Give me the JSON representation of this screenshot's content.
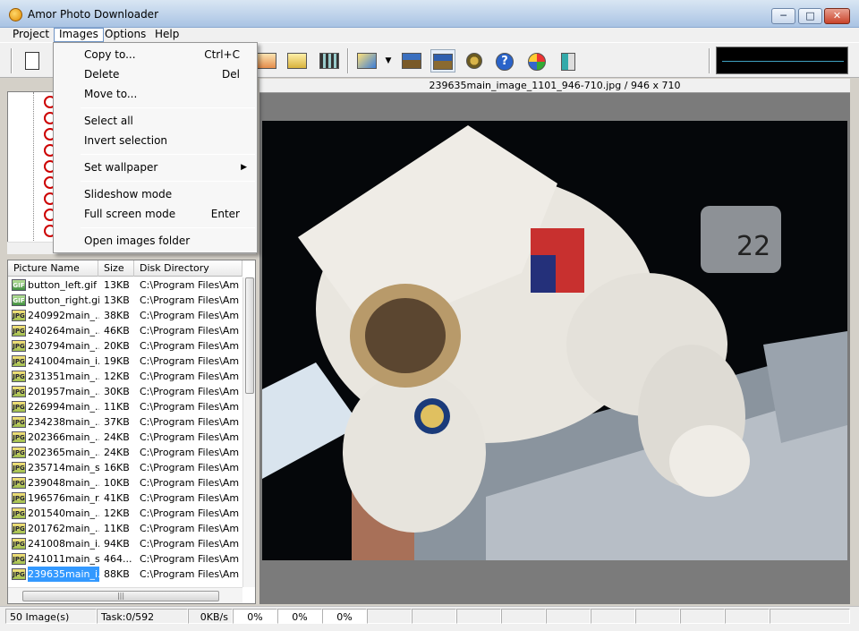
{
  "window": {
    "title": "Amor Photo Downloader",
    "min_glyph": "─",
    "max_glyph": "□",
    "close_glyph": "✕"
  },
  "menubar": {
    "project": "Project",
    "images": "Images",
    "options": "Options",
    "help": "Help"
  },
  "images_menu": {
    "copy": "Copy to...",
    "copy_shortcut": "Ctrl+C",
    "delete": "Delete",
    "delete_shortcut": "Del",
    "move": "Move to...",
    "select_all": "Select all",
    "invert": "Invert selection",
    "wallpaper": "Set wallpaper",
    "wallpaper_arrow": "▶",
    "slideshow": "Slideshow mode",
    "fullscreen": "Full screen mode",
    "fullscreen_shortcut": "Enter",
    "open_folder": "Open images folder"
  },
  "toolbar": {
    "icons": [
      "new-project-icon",
      "image-icon",
      "folder-icon",
      "film-icon",
      "edit-icon",
      "dropdown-arrow-icon",
      "landscape-icon",
      "fit-image-icon",
      "settings-icon",
      "help-icon",
      "globe-icon",
      "exit-icon"
    ],
    "dropdown_glyph": "▼",
    "help_glyph": "?"
  },
  "file_list": {
    "headers": {
      "name": "Picture Name",
      "size": "Size",
      "dir": "Disk Directory"
    },
    "scroll_grip": "|||",
    "rows": [
      {
        "type": "GIF",
        "name": "button_left.gif",
        "size": "13KB",
        "dir": "C:\\Program Files\\Am..."
      },
      {
        "type": "GIF",
        "name": "button_right.gif",
        "size": "13KB",
        "dir": "C:\\Program Files\\Am..."
      },
      {
        "type": "JPG",
        "name": "240992main_...",
        "size": "38KB",
        "dir": "C:\\Program Files\\Am..."
      },
      {
        "type": "JPG",
        "name": "240264main_...",
        "size": "46KB",
        "dir": "C:\\Program Files\\Am..."
      },
      {
        "type": "JPG",
        "name": "230794main_...",
        "size": "20KB",
        "dir": "C:\\Program Files\\Am..."
      },
      {
        "type": "JPG",
        "name": "241004main_i...",
        "size": "19KB",
        "dir": "C:\\Program Files\\Am..."
      },
      {
        "type": "JPG",
        "name": "231351main_...",
        "size": "12KB",
        "dir": "C:\\Program Files\\Am..."
      },
      {
        "type": "JPG",
        "name": "201957main_...",
        "size": "30KB",
        "dir": "C:\\Program Files\\Am..."
      },
      {
        "type": "JPG",
        "name": "226994main_...",
        "size": "11KB",
        "dir": "C:\\Program Files\\Am..."
      },
      {
        "type": "JPG",
        "name": "234238main_...",
        "size": "37KB",
        "dir": "C:\\Program Files\\Am..."
      },
      {
        "type": "JPG",
        "name": "202366main_...",
        "size": "24KB",
        "dir": "C:\\Program Files\\Am..."
      },
      {
        "type": "JPG",
        "name": "202365main_...",
        "size": "24KB",
        "dir": "C:\\Program Files\\Am..."
      },
      {
        "type": "JPG",
        "name": "235714main_s...",
        "size": "16KB",
        "dir": "C:\\Program Files\\Am..."
      },
      {
        "type": "JPG",
        "name": "239048main_...",
        "size": "10KB",
        "dir": "C:\\Program Files\\Am..."
      },
      {
        "type": "JPG",
        "name": "196576main_r...",
        "size": "41KB",
        "dir": "C:\\Program Files\\Am..."
      },
      {
        "type": "JPG",
        "name": "201540main_...",
        "size": "12KB",
        "dir": "C:\\Program Files\\Am..."
      },
      {
        "type": "JPG",
        "name": "201762main_...",
        "size": "11KB",
        "dir": "C:\\Program Files\\Am..."
      },
      {
        "type": "JPG",
        "name": "241008main_i...",
        "size": "94KB",
        "dir": "C:\\Program Files\\Am..."
      },
      {
        "type": "JPG",
        "name": "241011main_s...",
        "size": "464...",
        "dir": "C:\\Program Files\\Am..."
      },
      {
        "type": "JPG",
        "name": "239635main_i...",
        "size": "88KB",
        "dir": "C:\\Program Files\\Am...",
        "selected": true
      }
    ]
  },
  "viewer": {
    "caption": "239635main_image_1101_946-710.jpg / 946 x 710"
  },
  "statusbar": {
    "count": "50 Image(s)",
    "task": "Task:0/592",
    "speed": "0KB/s",
    "pct1": "0%",
    "pct2": "0%",
    "pct3": "0%"
  }
}
